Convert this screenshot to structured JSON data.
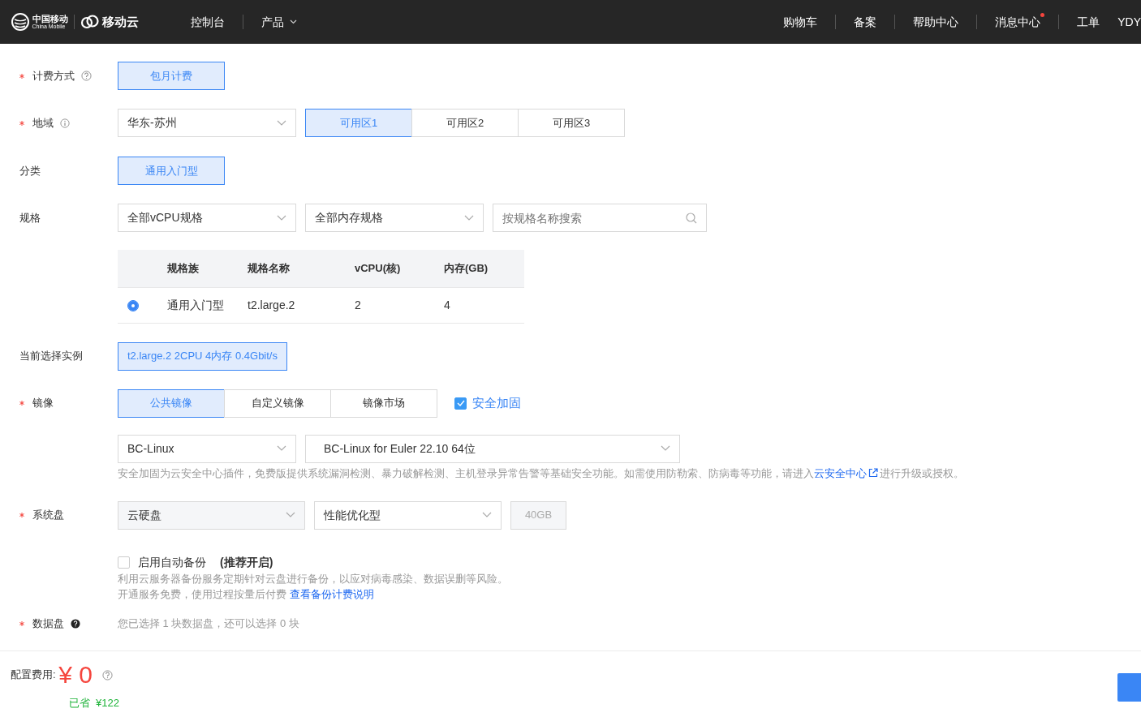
{
  "navbar": {
    "logo": {
      "brand_cn": "中国移动",
      "brand_en": "China Mobile",
      "product": "移动云"
    },
    "left_links": [
      {
        "label": "控制台",
        "dropdown": false
      },
      {
        "label": "产品",
        "dropdown": true
      }
    ],
    "right_links": [
      {
        "label": "购物车",
        "dot": false
      },
      {
        "label": "备案",
        "dot": false
      },
      {
        "label": "帮助中心",
        "dot": false
      },
      {
        "label": "消息中心",
        "dot": true
      },
      {
        "label": "工单",
        "dot": false
      }
    ],
    "user": "YDY"
  },
  "billing": {
    "label": "计费方式",
    "required": true,
    "help": {
      "kind": "question"
    },
    "options": [
      {
        "label": "包月计费",
        "selected": true
      }
    ]
  },
  "region": {
    "label": "地域",
    "required": true,
    "help": {
      "kind": "info"
    },
    "select": "华东-苏州",
    "zones": [
      {
        "label": "可用区1",
        "selected": true
      },
      {
        "label": "可用区2",
        "selected": false
      },
      {
        "label": "可用区3",
        "selected": false
      }
    ]
  },
  "category": {
    "label": "分类",
    "required": false,
    "options": [
      {
        "label": "通用入门型",
        "selected": true
      }
    ]
  },
  "spec": {
    "label": "规格",
    "required": false,
    "cpu_select": "全部vCPU规格",
    "mem_select": "全部内存规格",
    "search": {
      "placeholder": "按规格名称搜索"
    },
    "table": {
      "columns": [
        "规格族",
        "规格名称",
        "vCPU(核)",
        "内存(GB)"
      ],
      "rows": [
        {
          "selected": true,
          "cells": [
            "通用入门型",
            "t2.large.2",
            "2",
            "4"
          ]
        }
      ]
    }
  },
  "current_instance": {
    "label": "当前选择实例",
    "value": "t2.large.2 2CPU 4内存 0.4Gbit/s"
  },
  "image": {
    "label": "镜像",
    "required": true,
    "tabs": [
      {
        "label": "公共镜像",
        "selected": true
      },
      {
        "label": "自定义镜像",
        "selected": false
      },
      {
        "label": "镜像市场",
        "selected": false
      }
    ],
    "hardening": {
      "label": "安全加固",
      "checked": true
    },
    "os_select": "BC-Linux",
    "version_select": "BC-Linux for Euler 22.10 64位",
    "hint": {
      "before": "安全加固为云安全中心插件，免费版提供系统漏洞检测、暴力破解检测、主机登录异常告警等基础安全功能。如需使用防勒索、防病毒等功能，请进入",
      "link": "云安全中心",
      "after": "进行升级或授权。"
    }
  },
  "system_disk": {
    "label": "系统盘",
    "required": true,
    "type_select": "云硬盘",
    "perf_select": "性能优化型",
    "size": "40GB",
    "backup": {
      "label": "启用自动备份",
      "note": "(推荐开启)",
      "checked": false
    },
    "desc": "利用云服务器备份服务定期针对云盘进行备份，以应对病毒感染、数据误删等风险。",
    "fee_text": "开通服务免费，使用过程按量后付费",
    "fee_link": "查看备份计费说明"
  },
  "data_disk": {
    "label": "数据盘",
    "required": true,
    "help": {
      "kind": "filled"
    },
    "summary": "您已选择 1 块数据盘，还可以选择 0 块"
  },
  "footer": {
    "fee_label": "配置费用:",
    "price": "¥ 0",
    "saved_label": "已省",
    "saved": "¥122"
  }
}
